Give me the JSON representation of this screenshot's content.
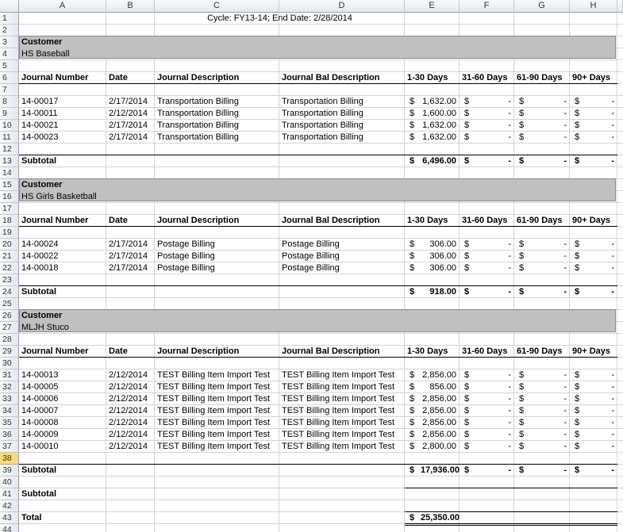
{
  "columns": [
    "A",
    "B",
    "C",
    "D",
    "E",
    "F",
    "G",
    "H"
  ],
  "rows": [
    1,
    2,
    3,
    4,
    5,
    6,
    7,
    8,
    9,
    10,
    11,
    12,
    13,
    14,
    15,
    16,
    17,
    18,
    19,
    20,
    21,
    22,
    23,
    24,
    25,
    26,
    27,
    28,
    29,
    30,
    31,
    32,
    33,
    34,
    35,
    36,
    37,
    38,
    39,
    40,
    41,
    42,
    43,
    44
  ],
  "selected_row": 38,
  "cycle_title": "Cycle: FY13-14; End Date: 2/28/2014",
  "headers": {
    "journal_number": "Journal Number",
    "date": "Date",
    "journal_description": "Journal Description",
    "journal_bal_description": "Journal Bal Description",
    "d1_30": "1-30 Days",
    "d31_60": "31-60 Days",
    "d61_90": "61-90 Days",
    "d90_plus": "90+ Days"
  },
  "customer_label": "Customer",
  "subtotal_label": "Subtotal",
  "total_label": "Total",
  "currency_symbol": "$",
  "dash": "-",
  "groups": [
    {
      "name": "HS Baseball",
      "entries": [
        {
          "jn": "14-00017",
          "date": "2/17/2014",
          "desc": "Transportation Billing",
          "bal": "Transportation Billing",
          "amt": "1,632.00"
        },
        {
          "jn": "14-00011",
          "date": "2/12/2014",
          "desc": "Transportation Billing",
          "bal": "Transportation Billing",
          "amt": "1,600.00"
        },
        {
          "jn": "14-00021",
          "date": "2/17/2014",
          "desc": "Transportation Billing",
          "bal": "Transportation Billing",
          "amt": "1,632.00"
        },
        {
          "jn": "14-00023",
          "date": "2/17/2014",
          "desc": "Transportation Billing",
          "bal": "Transportation Billing",
          "amt": "1,632.00"
        }
      ],
      "subtotal": "6,496.00"
    },
    {
      "name": "HS Girls Basketball",
      "entries": [
        {
          "jn": "14-00024",
          "date": "2/17/2014",
          "desc": "Postage Billing",
          "bal": "Postage Billing",
          "amt": "306.00"
        },
        {
          "jn": "14-00022",
          "date": "2/17/2014",
          "desc": "Postage Billing",
          "bal": "Postage Billing",
          "amt": "306.00"
        },
        {
          "jn": "14-00018",
          "date": "2/17/2014",
          "desc": "Postage Billing",
          "bal": "Postage Billing",
          "amt": "306.00"
        }
      ],
      "subtotal": "918.00"
    },
    {
      "name": "MLJH Stuco",
      "entries": [
        {
          "jn": "14-00013",
          "date": "2/12/2014",
          "desc": "TEST Billing Item Import Test",
          "bal": "TEST Billing Item Import Test",
          "amt": "2,856.00"
        },
        {
          "jn": "14-00005",
          "date": "2/12/2014",
          "desc": "TEST Billing Item Import Test",
          "bal": "TEST Billing Item Import Test",
          "amt": "856.00"
        },
        {
          "jn": "14-00006",
          "date": "2/12/2014",
          "desc": "TEST Billing Item Import Test",
          "bal": "TEST Billing Item Import Test",
          "amt": "2,856.00"
        },
        {
          "jn": "14-00007",
          "date": "2/12/2014",
          "desc": "TEST Billing Item Import Test",
          "bal": "TEST Billing Item Import Test",
          "amt": "2,856.00"
        },
        {
          "jn": "14-00008",
          "date": "2/12/2014",
          "desc": "TEST Billing Item Import Test",
          "bal": "TEST Billing Item Import Test",
          "amt": "2,856.00"
        },
        {
          "jn": "14-00009",
          "date": "2/12/2014",
          "desc": "TEST Billing Item Import Test",
          "bal": "TEST Billing Item Import Test",
          "amt": "2,856.00"
        },
        {
          "jn": "14-00010",
          "date": "2/12/2014",
          "desc": "TEST Billing Item Import Test",
          "bal": "TEST Billing Item Import Test",
          "amt": "2,800.00"
        }
      ],
      "subtotal": "17,936.00"
    }
  ],
  "grand_total": "25,350.00",
  "colors": {
    "band": "#c0c0c0",
    "selected_row_header": "#f9d978",
    "gridline": "#d4d4d4"
  }
}
